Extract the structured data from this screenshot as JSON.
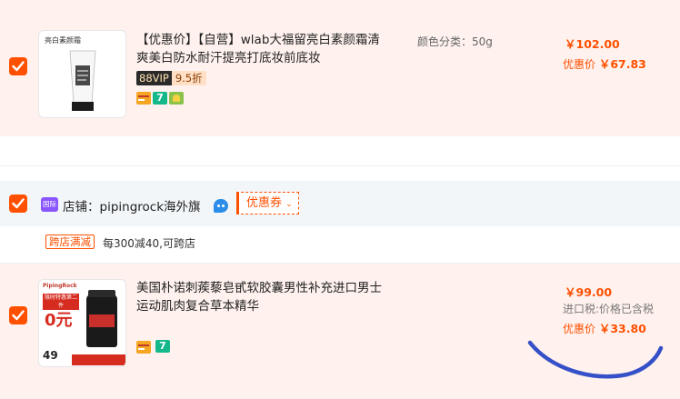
{
  "item1": {
    "title": "【优惠价】【自营】wlab大福留亮白素颜霜清爽美白防水耐汗提亮打底妆前底妆",
    "thumb_label": "亮白素颜霜",
    "vip_label": "88VIP",
    "vip_discount": "9.5折",
    "spec": "颜色分类：50g",
    "price": "￥102.00",
    "promo_label": "优惠价",
    "promo_price": "￥67.83",
    "checked": true
  },
  "store": {
    "badge": "国际",
    "label": "店铺：pipingrock海外旗",
    "coupon": "优惠券",
    "checked": true
  },
  "promo": {
    "tag": "跨店满减",
    "text": "每300减40,可跨店"
  },
  "item2": {
    "title": "美国朴诺刺蒺藜皂甙软胶囊男性补充进口男士运动肌肉复合草本精华",
    "thumb_brand": "PipingRock",
    "thumb_headline": "限时特惠第二件",
    "thumb_big": "0元",
    "thumb_count": "49",
    "price": "￥99.00",
    "tax_note": "进口税:价格已含税",
    "promo_label": "优惠价",
    "promo_price": "￥33.80",
    "checked": true
  },
  "colors": {
    "accent": "#ff5000",
    "row_bg": "#fff2ee",
    "store_bg": "#f2f6f9",
    "annotation": "#3550c8"
  }
}
